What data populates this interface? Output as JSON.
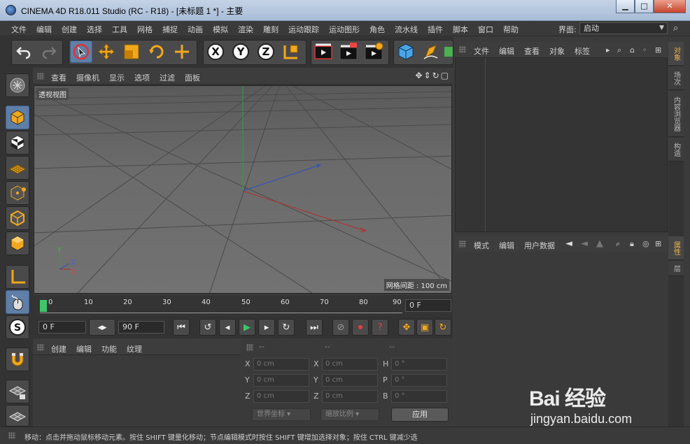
{
  "window": {
    "title": "CINEMA 4D R18.011 Studio (RC - R18) - [未标题 1 *] - 主要",
    "minimize": "▁",
    "maximize": "□",
    "close": "✕"
  },
  "menu": {
    "items": [
      "文件",
      "编辑",
      "创建",
      "选择",
      "工具",
      "网格",
      "捕捉",
      "动画",
      "模拟",
      "渲染",
      "雕刻",
      "运动跟踪",
      "运动图形",
      "角色",
      "流水线",
      "插件",
      "脚本",
      "窗口",
      "帮助"
    ],
    "layout_label": "界面:",
    "layout_value": "启动"
  },
  "viewport": {
    "menu": [
      "查看",
      "摄像机",
      "显示",
      "选项",
      "过滤",
      "面板"
    ],
    "label": "透视视图",
    "grid_spacing": "网格间距 : 100 cm",
    "nav_icons": "✥⇕↻▢",
    "axis_x": "X",
    "axis_y": "Y",
    "axis_z": "Z"
  },
  "timeline": {
    "ticks": [
      "0",
      "10",
      "20",
      "30",
      "40",
      "50",
      "60",
      "70",
      "80",
      "90"
    ],
    "current_frame": "0 F",
    "start_frame": "0 F",
    "end_frame": "90 F"
  },
  "material_panel": {
    "menu": [
      "创建",
      "编辑",
      "功能",
      "纹理"
    ]
  },
  "coords": {
    "headers": [
      "--",
      "--",
      "--"
    ],
    "rows": [
      {
        "a": "X",
        "av": "0 cm",
        "b": "X",
        "bv": "0 cm",
        "c": "H",
        "cv": "0 °"
      },
      {
        "a": "Y",
        "av": "0 cm",
        "b": "Y",
        "bv": "0 cm",
        "c": "P",
        "cv": "0 °"
      },
      {
        "a": "Z",
        "av": "0 cm",
        "b": "Z",
        "bv": "0 cm",
        "c": "B",
        "cv": "0 °"
      }
    ],
    "world_coords": "世界坐标",
    "scale": "缩放比例",
    "apply": "应用"
  },
  "object_manager": {
    "menu": [
      "文件",
      "编辑",
      "查看",
      "对象",
      "标签"
    ]
  },
  "attribute_manager": {
    "menu": [
      "模式",
      "编辑",
      "用户数据"
    ]
  },
  "right_tabs": {
    "top": [
      "对象",
      "场次",
      "内容浏览器",
      "构造"
    ],
    "bottom": [
      "属性",
      "层"
    ]
  },
  "status": "移动：点击并拖动鼠标移动元素。按住 SHIFT 键量化移动；节点编辑模式时按住 SHIFT 键增加选择对象；按住 CTRL 键减少选",
  "watermark": {
    "logo": "Bai 经验",
    "url": "jingyan.baidu.com"
  },
  "colors": {
    "accent_blue": "#5f7fa6",
    "playhead_green": "#3ec66b",
    "active_tab": "#f1b447",
    "axis_x": "#c0392b",
    "axis_y": "#27ae60",
    "axis_z": "#2e4fbf"
  }
}
